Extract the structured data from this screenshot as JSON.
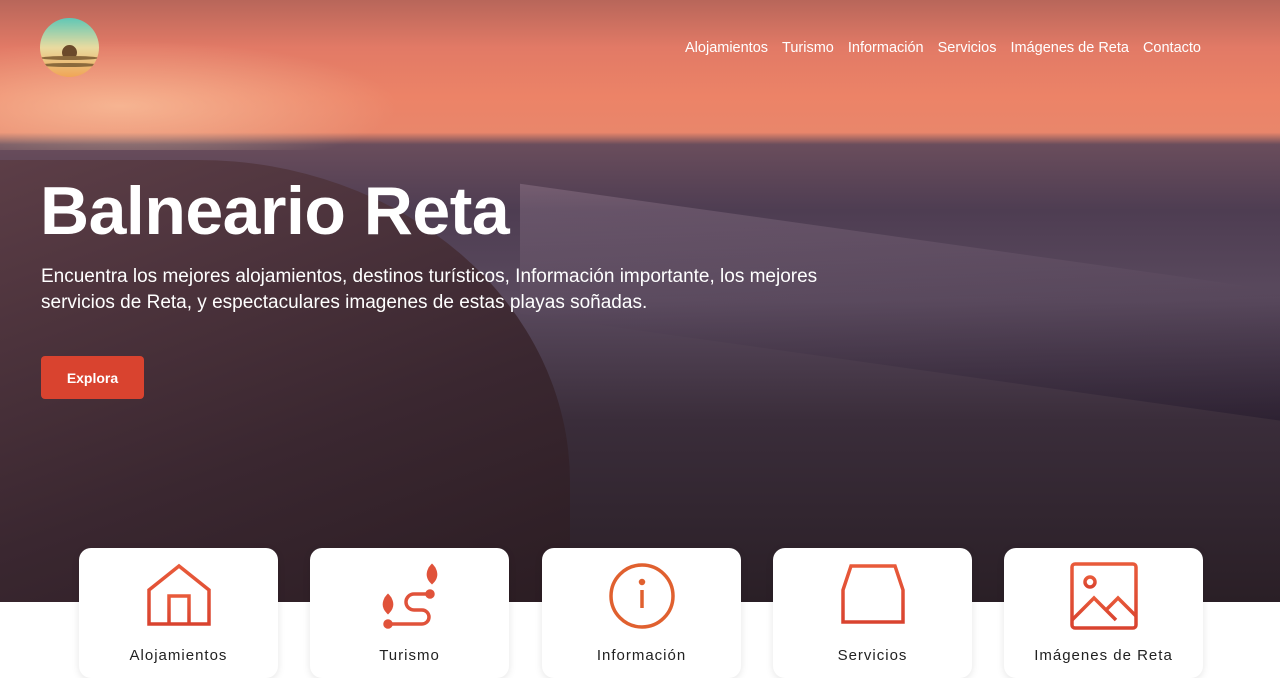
{
  "nav": {
    "items": [
      "Alojamientos",
      "Turismo",
      "Información",
      "Servicios",
      "Imágenes de Reta",
      "Contacto"
    ]
  },
  "hero": {
    "title": "Balneario Reta",
    "subtitle": "Encuentra los mejores alojamientos, destinos turísticos, Información importante, los mejores servicios de Reta, y espectaculares imagenes de estas playas soñadas.",
    "button": "Explora"
  },
  "cards": [
    {
      "label": "Alojamientos",
      "icon": "house-icon"
    },
    {
      "label": "Turismo",
      "icon": "route-icon"
    },
    {
      "label": "Información",
      "icon": "info-icon"
    },
    {
      "label": "Servicios",
      "icon": "server-icon"
    },
    {
      "label": "Imágenes de Reta",
      "icon": "image-icon"
    }
  ],
  "colors": {
    "accent": "#d9432f"
  }
}
